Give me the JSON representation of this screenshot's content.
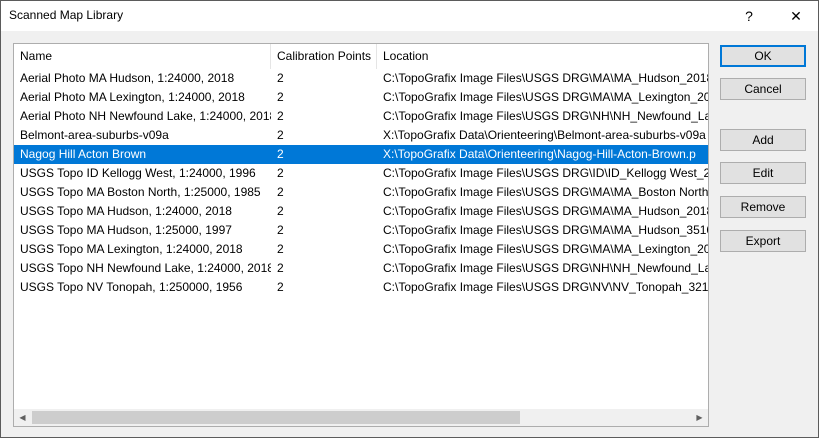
{
  "window": {
    "title": "Scanned Map Library",
    "help_glyph": "?",
    "close_glyph": "✕"
  },
  "table": {
    "columns": [
      "Name",
      "Calibration Points",
      "Location"
    ],
    "selected_index": 4,
    "rows": [
      {
        "name": "Aerial Photo MA Hudson, 1:24000, 2018",
        "cal": "2",
        "loc": "C:\\TopoGrafix Image Files\\USGS DRG\\MA\\MA_Hudson_20180"
      },
      {
        "name": "Aerial Photo MA Lexington, 1:24000, 2018",
        "cal": "2",
        "loc": "C:\\TopoGrafix Image Files\\USGS DRG\\MA\\MA_Lexington_201"
      },
      {
        "name": "Aerial Photo NH Newfound Lake, 1:24000, 2018",
        "cal": "2",
        "loc": "C:\\TopoGrafix Image Files\\USGS DRG\\NH\\NH_Newfound_Lak"
      },
      {
        "name": "Belmont-area-suburbs-v09a",
        "cal": "2",
        "loc": "X:\\TopoGrafix Data\\Orienteering\\Belmont-area-suburbs-v09a"
      },
      {
        "name": "Nagog Hill Acton Brown",
        "cal": "2",
        "loc": "X:\\TopoGrafix Data\\Orienteering\\Nagog-Hill-Acton-Brown.p"
      },
      {
        "name": "USGS Topo ID Kellogg West, 1:24000, 1996",
        "cal": "2",
        "loc": "C:\\TopoGrafix Image Files\\USGS DRG\\ID\\ID_Kellogg West_236"
      },
      {
        "name": "USGS Topo MA Boston North, 1:25000, 1985",
        "cal": "2",
        "loc": "C:\\TopoGrafix Image Files\\USGS DRG\\MA\\MA_Boston North_"
      },
      {
        "name": "USGS Topo MA Hudson, 1:24000, 2018",
        "cal": "2",
        "loc": "C:\\TopoGrafix Image Files\\USGS DRG\\MA\\MA_Hudson_20180"
      },
      {
        "name": "USGS Topo MA Hudson, 1:25000, 1997",
        "cal": "2",
        "loc": "C:\\TopoGrafix Image Files\\USGS DRG\\MA\\MA_Hudson_35102"
      },
      {
        "name": "USGS Topo MA Lexington, 1:24000, 2018",
        "cal": "2",
        "loc": "C:\\TopoGrafix Image Files\\USGS DRG\\MA\\MA_Lexington_201"
      },
      {
        "name": "USGS Topo NH Newfound Lake, 1:24000, 2018",
        "cal": "2",
        "loc": "C:\\TopoGrafix Image Files\\USGS DRG\\NH\\NH_Newfound_Lak"
      },
      {
        "name": "USGS Topo NV Tonopah, 1:250000, 1956",
        "cal": "2",
        "loc": "C:\\TopoGrafix Image Files\\USGS DRG\\NV\\NV_Tonopah_32178"
      }
    ]
  },
  "buttons": {
    "ok": "OK",
    "cancel": "Cancel",
    "add": "Add",
    "edit": "Edit",
    "remove": "Remove",
    "export": "Export"
  },
  "colors": {
    "selection": "#0078d7",
    "default_button_border": "#0078d7"
  }
}
